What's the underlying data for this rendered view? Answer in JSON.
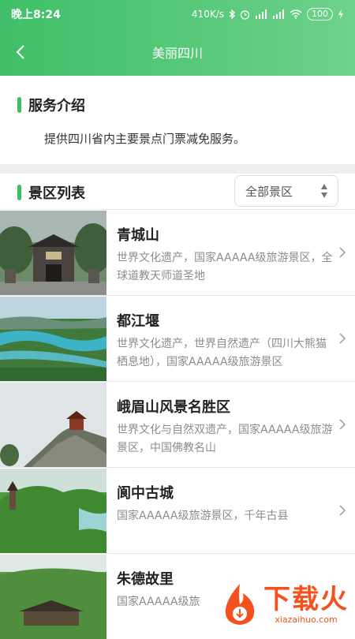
{
  "status_bar": {
    "time": "晚上8:24",
    "network_speed": "410K/s",
    "battery": "100"
  },
  "header": {
    "title": "美丽四川"
  },
  "intro": {
    "title": "服务介绍",
    "text": "提供四川省内主要景点门票减免服务。"
  },
  "list_section": {
    "title": "景区列表",
    "filter_selected": "全部景区"
  },
  "scenic_spots": [
    {
      "name": "青城山",
      "desc": "世界文化遗产，国家AAAAA级旅游景区，全球道教天师道圣地"
    },
    {
      "name": "都江堰",
      "desc": "世界文化遗产，世界自然遗产（四川大熊猫栖息地），国家AAAAA级旅游景区"
    },
    {
      "name": "峨眉山风景名胜区",
      "desc": "世界文化与自然双遗产，国家AAAAA级旅游景区，中国佛教名山"
    },
    {
      "name": "阆中古城",
      "desc": "国家AAAAA级旅游景区，千年古县"
    },
    {
      "name": "朱德故里",
      "desc": "国家AAAAA级旅"
    }
  ],
  "watermark": {
    "text": "下载火",
    "url": "xiazaihuo.com"
  },
  "colors": {
    "header_green": "#4cc471",
    "accent_green": "#3cbf63",
    "watermark_orange": "#f4511e"
  }
}
